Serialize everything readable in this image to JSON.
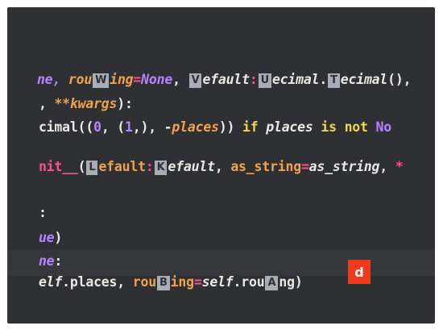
{
  "colors": {
    "background": "#2f3033",
    "active_hint": "#ef3a1e",
    "hint_bg": "#a8adb6"
  },
  "code": {
    "line1": {
      "a": "ne, ",
      "b": "rou",
      "c": "ing",
      "d": "=",
      "e": "None",
      "f": ", ",
      "g": "efault",
      "h": ":",
      "i": "ecimal",
      "j": ".",
      "k": "ecimal",
      "l": "()",
      "m": ","
    },
    "line2": {
      "a": ", ",
      "b": "**kwargs",
      "c": "):"
    },
    "line3": {
      "a": "cimal((",
      "b": "0",
      "c": ", (",
      "d": "1",
      "e": ",), -",
      "f": "places",
      "g": ")) ",
      "h": "if",
      "i": " places ",
      "j": "is not",
      "k": " No"
    },
    "line4": {
      "a": "nit__",
      "b": "(",
      "c": "efault",
      "d": ":",
      "e": "efault",
      "f": ", ",
      "g": "as_string",
      "h": "=",
      "i": "as_string",
      "j": ", ",
      "k": "*"
    },
    "line5": {
      "a": ":"
    },
    "line6": {
      "a": "ue",
      "b": ")"
    },
    "line7": {
      "a": "ne",
      "b": ":"
    },
    "line8": {
      "a": "elf",
      "b": ".places, ",
      "c": "rou",
      "d": "ing",
      "e": "=",
      "f": "self",
      "g": ".rou",
      "h": "ng)"
    }
  },
  "hints": {
    "W": "W",
    "V": "V",
    "U": "U",
    "T": "T",
    "L": "L",
    "K": "K",
    "B": "B",
    "A": "A",
    "active": "d"
  }
}
